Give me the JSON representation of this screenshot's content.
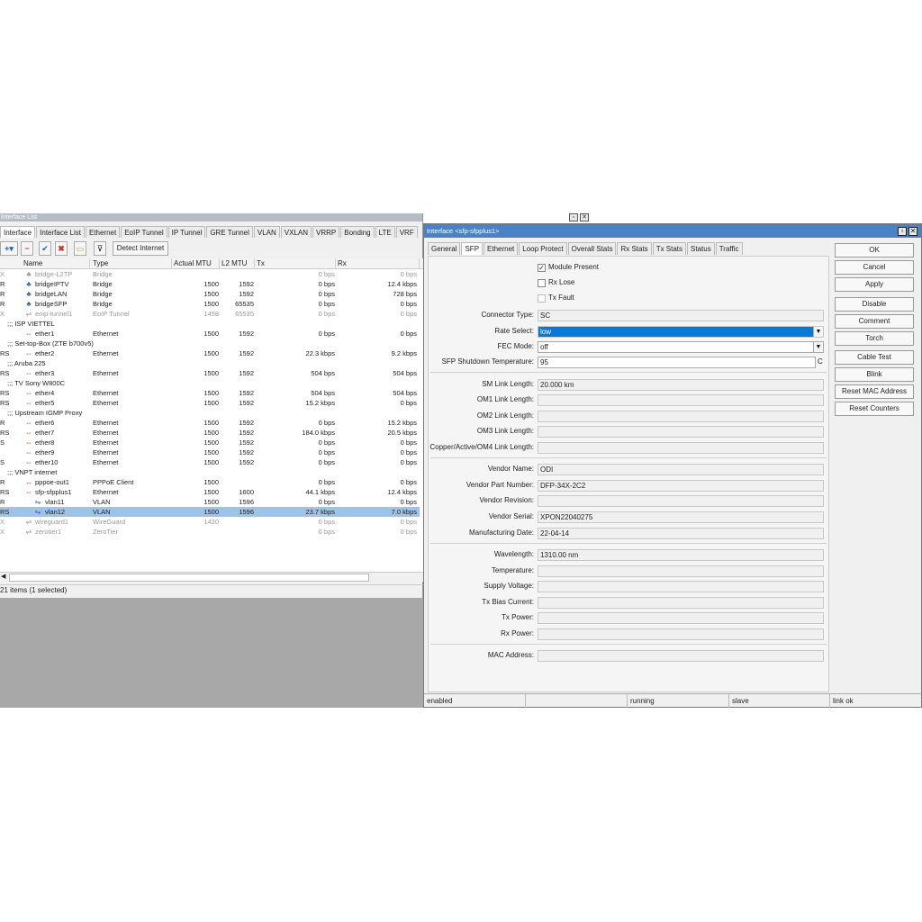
{
  "left_window": {
    "title": "Interface List",
    "tabs": [
      "Interface",
      "Interface List",
      "Ethernet",
      "EoIP Tunnel",
      "IP Tunnel",
      "GRE Tunnel",
      "VLAN",
      "VXLAN",
      "VRRP",
      "Bonding",
      "LTE",
      "VRF"
    ],
    "toolbar": {
      "detect_internet": "Detect Internet"
    },
    "columns": [
      "Name",
      "Type",
      "Actual MTU",
      "L2 MTU",
      "Tx",
      "Rx"
    ],
    "rows": [
      {
        "flag": "X",
        "name": "bridge-L2TP",
        "type": "Bridge",
        "mtu": "",
        "l2": "",
        "tx": "0 bps",
        "rx": "0 bps"
      },
      {
        "flag": "R",
        "name": "bridgeIPTV",
        "type": "Bridge",
        "mtu": "1500",
        "l2": "1592",
        "tx": "0 bps",
        "rx": "12.4 kbps"
      },
      {
        "flag": "R",
        "name": "bridgeLAN",
        "type": "Bridge",
        "mtu": "1500",
        "l2": "1592",
        "tx": "0 bps",
        "rx": "728 bps"
      },
      {
        "flag": "R",
        "name": "bridgeSFP",
        "type": "Bridge",
        "mtu": "1500",
        "l2": "65535",
        "tx": "0 bps",
        "rx": "0 bps"
      },
      {
        "flag": "X",
        "name": "eoip-tunnel1",
        "type": "EoIP Tunnel",
        "mtu": "1458",
        "l2": "65535",
        "tx": "0 bps",
        "rx": "0 bps"
      },
      {
        "comment": ";;; ISP VIETTEL"
      },
      {
        "flag": "",
        "name": "ether1",
        "type": "Ethernet",
        "mtu": "1500",
        "l2": "1592",
        "tx": "0 bps",
        "rx": "0 bps"
      },
      {
        "comment": ";;; Set-top-Box (ZTE b700v5)"
      },
      {
        "flag": "RS",
        "name": "ether2",
        "type": "Ethernet",
        "mtu": "1500",
        "l2": "1592",
        "tx": "22.3 kbps",
        "rx": "9.2 kbps"
      },
      {
        "comment": ";;; Aruba 225"
      },
      {
        "flag": "RS",
        "name": "ether3",
        "type": "Ethernet",
        "mtu": "1500",
        "l2": "1592",
        "tx": "504 bps",
        "rx": "504 bps"
      },
      {
        "comment": ";;; TV Sony W800C"
      },
      {
        "flag": "RS",
        "name": "ether4",
        "type": "Ethernet",
        "mtu": "1500",
        "l2": "1592",
        "tx": "504 bps",
        "rx": "504 bps"
      },
      {
        "flag": "RS",
        "name": "ether5",
        "type": "Ethernet",
        "mtu": "1500",
        "l2": "1592",
        "tx": "15.2 kbps",
        "rx": "0 bps"
      },
      {
        "comment": ";;; Upstream IGMP Proxy"
      },
      {
        "flag": "R",
        "name": "ether6",
        "type": "Ethernet",
        "mtu": "1500",
        "l2": "1592",
        "tx": "0 bps",
        "rx": "15.2 kbps"
      },
      {
        "flag": "RS",
        "name": "ether7",
        "type": "Ethernet",
        "mtu": "1500",
        "l2": "1592",
        "tx": "184.0 kbps",
        "rx": "20.5 kbps"
      },
      {
        "flag": "S",
        "name": "ether8",
        "type": "Ethernet",
        "mtu": "1500",
        "l2": "1592",
        "tx": "0 bps",
        "rx": "0 bps"
      },
      {
        "flag": "",
        "name": "ether9",
        "type": "Ethernet",
        "mtu": "1500",
        "l2": "1592",
        "tx": "0 bps",
        "rx": "0 bps"
      },
      {
        "flag": "S",
        "name": "ether10",
        "type": "Ethernet",
        "mtu": "1500",
        "l2": "1592",
        "tx": "0 bps",
        "rx": "0 bps"
      },
      {
        "comment": ";;; VNPT internet"
      },
      {
        "flag": "R",
        "name": "pppoe-out1",
        "type": "PPPoE Client",
        "mtu": "1500",
        "l2": "",
        "tx": "0 bps",
        "rx": "0 bps"
      },
      {
        "flag": "RS",
        "name": "sfp-sfpplus1",
        "type": "Ethernet",
        "mtu": "1500",
        "l2": "1600",
        "tx": "44.1 kbps",
        "rx": "12.4 kbps"
      },
      {
        "flag": "R",
        "name": "vlan11",
        "type": "VLAN",
        "mtu": "1500",
        "l2": "1596",
        "tx": "0 bps",
        "rx": "0 bps"
      },
      {
        "flag": "RS",
        "name": "vlan12",
        "type": "VLAN",
        "mtu": "1500",
        "l2": "1596",
        "tx": "23.7 kbps",
        "rx": "7.0 kbps"
      },
      {
        "flag": "X",
        "name": "wireguard1",
        "type": "WireGuard",
        "mtu": "1420",
        "l2": "",
        "tx": "0 bps",
        "rx": "0 bps"
      },
      {
        "flag": "X",
        "name": "zerotier1",
        "type": "ZeroTier",
        "mtu": "",
        "l2": "",
        "tx": "0 bps",
        "rx": "0 bps"
      }
    ],
    "status": "21 items (1 selected)"
  },
  "right_window": {
    "title": "Interface <sfp-sfpplus1>",
    "tabs": [
      "General",
      "SFP",
      "Ethernet",
      "Loop Protect",
      "Overall Stats",
      "Rx Stats",
      "Tx Stats",
      "Status",
      "Traffic"
    ],
    "checks": [
      {
        "label": "Module Present",
        "checked": true
      },
      {
        "label": "Rx Lose",
        "checked": false
      },
      {
        "label": "Tx Fault",
        "checked": false
      }
    ],
    "fields": {
      "connector_type": {
        "label": "Connector Type:",
        "value": "SC"
      },
      "rate_select": {
        "label": "Rate Select:",
        "value": "low"
      },
      "fec_mode": {
        "label": "FEC Mode:",
        "value": "off"
      },
      "shutdown_temp": {
        "label": "SFP Shutdown Temperature:",
        "value": "95",
        "unit": "C"
      },
      "sm_len": {
        "label": "SM Link Length:",
        "value": "20.000 km"
      },
      "om1_len": {
        "label": "OM1 Link Length:",
        "value": ""
      },
      "om2_len": {
        "label": "OM2 Link Length:",
        "value": ""
      },
      "om3_len": {
        "label": "OM3 Link Length:",
        "value": ""
      },
      "copper_len": {
        "label": "Copper/Active/OM4 Link Length:",
        "value": ""
      },
      "vendor_name": {
        "label": "Vendor Name:",
        "value": "ODI"
      },
      "vendor_part": {
        "label": "Vendor Part Number:",
        "value": "DFP-34X-2C2"
      },
      "vendor_rev": {
        "label": "Vendor Revision:",
        "value": ""
      },
      "vendor_serial": {
        "label": "Vendor Serial:",
        "value": "XPON22040275"
      },
      "mfg_date": {
        "label": "Manufacturing Date:",
        "value": "22-04-14"
      },
      "wavelength": {
        "label": "Wavelength:",
        "value": "1310.00 nm"
      },
      "temperature": {
        "label": "Temperature:",
        "value": ""
      },
      "supply_voltage": {
        "label": "Supply Voltage:",
        "value": ""
      },
      "tx_bias": {
        "label": "Tx Bias Current:",
        "value": ""
      },
      "tx_power": {
        "label": "Tx Power:",
        "value": ""
      },
      "rx_power": {
        "label": "Rx Power:",
        "value": ""
      },
      "mac": {
        "label": "MAC Address:",
        "value": ""
      }
    },
    "buttons": [
      "OK",
      "Cancel",
      "Apply",
      "Disable",
      "Comment",
      "Torch",
      "Cable Test",
      "Blink",
      "Reset MAC Address",
      "Reset Counters"
    ],
    "status": [
      "enabled",
      "",
      "running",
      "slave",
      "link ok"
    ]
  }
}
